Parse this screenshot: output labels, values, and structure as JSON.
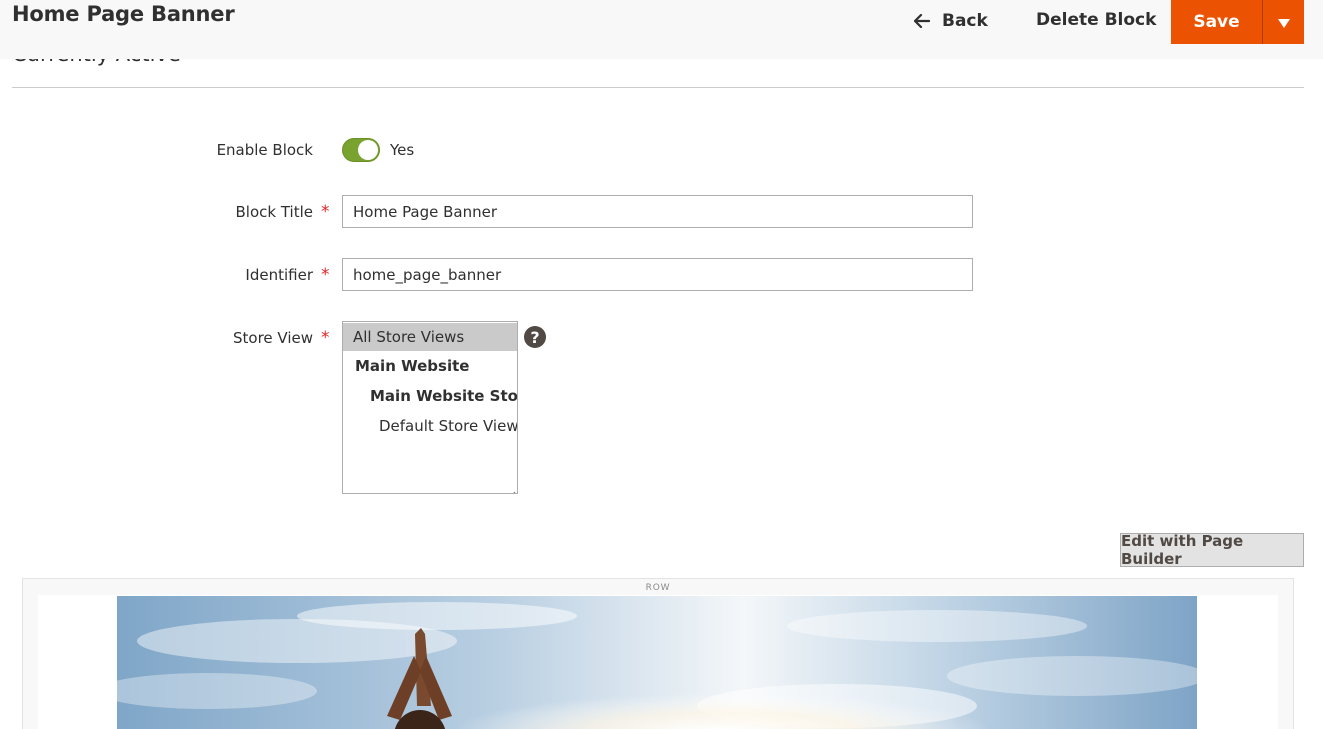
{
  "header": {
    "page_title": "Home Page Banner",
    "back_label": "Back",
    "delete_label": "Delete Block",
    "save_label": "Save"
  },
  "section": {
    "title": "Currently Active"
  },
  "form": {
    "enable_block": {
      "label": "Enable Block",
      "value": "Yes",
      "checked": true
    },
    "block_title": {
      "label": "Block Title",
      "value": "Home Page Banner",
      "required": true
    },
    "identifier": {
      "label": "Identifier",
      "value": "home_page_banner",
      "required": true
    },
    "store_view": {
      "label": "Store View",
      "required": true,
      "options": [
        {
          "label": "All Store Views",
          "selected": true
        },
        {
          "label": "Main Website"
        },
        {
          "label": "Main Website Store"
        },
        {
          "label": "Default Store View"
        }
      ]
    }
  },
  "page_builder": {
    "edit_label": "Edit with Page Builder",
    "row_label": "ROW"
  },
  "colors": {
    "accent": "#eb5202",
    "toggle_on": "#79a22e",
    "required": "#e22626"
  },
  "icons": [
    "arrow-left-icon",
    "caret-down-icon",
    "help-icon"
  ]
}
